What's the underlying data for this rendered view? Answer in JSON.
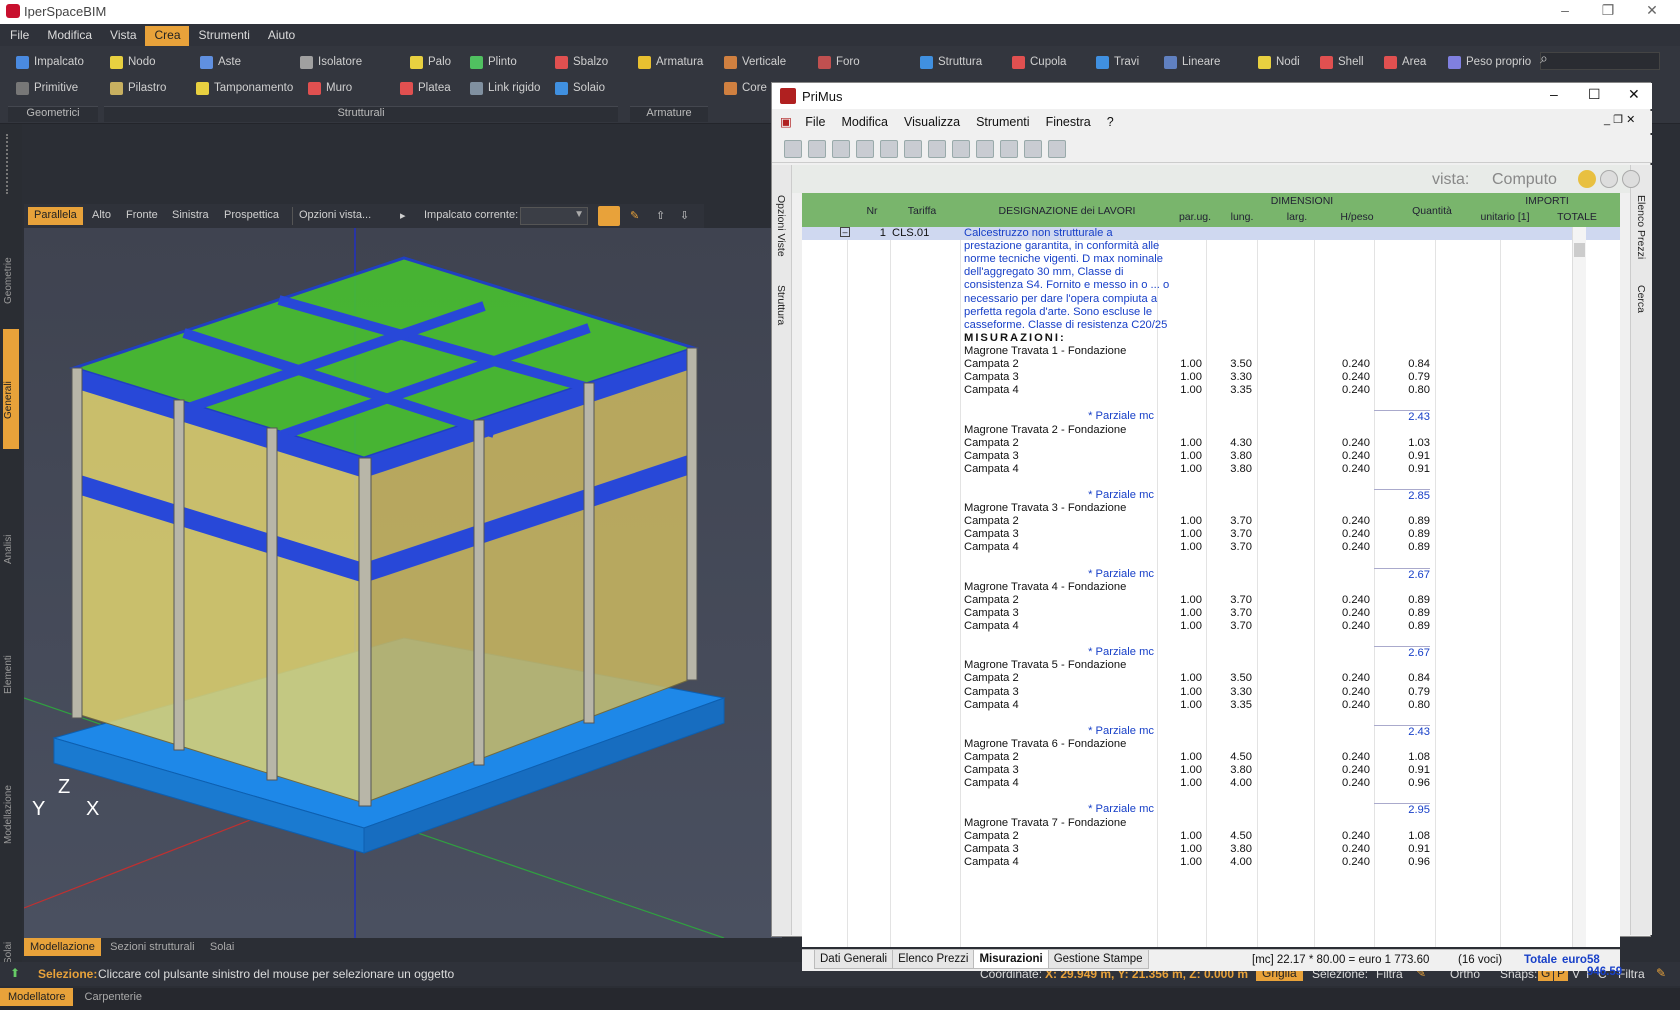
{
  "app": {
    "title": "IperSpaceBIM",
    "menus": [
      "File",
      "Modifica",
      "Vista",
      "Crea",
      "Strumenti",
      "Aiuto"
    ],
    "active_menu": "Crea"
  },
  "ribbon": {
    "row1": [
      "Impalcato",
      "Nodo",
      "Aste",
      "Isolatore",
      "Palo",
      "Plinto",
      "Sbalzo",
      "Armatura",
      "Verticale",
      "Foro",
      "Struttura",
      "Cupola",
      "Travi",
      "Lineare",
      "Nodi",
      "Shell",
      "Area",
      "Peso proprio"
    ],
    "row2": [
      "Primitive",
      "Pilastro",
      "Tamponamento",
      "Muro",
      "Platea",
      "Link rigido",
      "Solaio",
      "Core"
    ],
    "groups": [
      "Geometrici",
      "Strutturali",
      "Armature"
    ]
  },
  "left_tabs": [
    "Geometrie",
    "Generali",
    "Analisi",
    "Elementi",
    "Modellazione",
    "Solai"
  ],
  "active_left_tab": "Generali",
  "viewbar": {
    "buttons": [
      "Parallela",
      "Alto",
      "Fronte",
      "Sinistra",
      "Prospettica"
    ],
    "options": "Opzioni vista...",
    "impalcato_label": "Impalcato corrente:",
    "active": "Parallela"
  },
  "axes": {
    "z": "Z",
    "y": "Y",
    "x": "X"
  },
  "bottom_tabs": [
    "Modellazione",
    "Sezioni strutturali",
    "Solai"
  ],
  "status": {
    "label": "Selezione:",
    "message": "Cliccare col pulsante sinistro del mouse per selezionare un oggetto",
    "coords_label": "Coordinate:",
    "coords": "X: 29.949 m, Y: 21.356 m, Z: 0.000 m",
    "griglia": "Griglia",
    "selezione": "Selezione:",
    "filtra": "Filtra",
    "ortho": "Ortho",
    "snaps": "Snaps:",
    "snap_keys": [
      "G",
      "P",
      "V",
      "I",
      "C"
    ],
    "filtra2": "Filtra"
  },
  "foot_tabs": [
    "Modellatore",
    "Carpenterie"
  ],
  "primus": {
    "title": "PriMus",
    "menus": [
      "File",
      "Modifica",
      "Visualizza",
      "Strumenti",
      "Finestra",
      "?"
    ],
    "side_left": [
      "Opzioni Viste",
      "Struttura"
    ],
    "side_right": [
      "Elenco Prezzi",
      "Cerca"
    ],
    "vista_label": "vista:",
    "vista_value": "Computo",
    "headers": {
      "nr": "Nr",
      "tariffa": "Tariffa",
      "designazione": "DESIGNAZIONE dei LAVORI",
      "dimensioni": "DIMENSIONI",
      "par_ug": "par.ug.",
      "lung": "lung.",
      "larg": "larg.",
      "hpeso": "H/peso",
      "quantita": "Quantità",
      "importi": "IMPORTI",
      "unitario": "unitario [1]",
      "totale": "TOTALE"
    },
    "item": {
      "nr": "1",
      "tariffa": "CLS.01",
      "desc": [
        "Calcestruzzo non strutturale a",
        "prestazione garantita, in conformità alle",
        "norme tecniche vigenti. D max nominale",
        "dell'aggregato 30 mm, Classe di",
        "consistenza S4. Fornito e messo in o ... o",
        "necessario per dare l'opera compiuta a",
        "perfetta regola d'arte. Sono escluse le",
        "casseforme. Classe di resistenza C20/25"
      ],
      "misurazioni": "MISURAZIONI:"
    },
    "groups": [
      {
        "title": "Magrone Travata 1 - Fondazione",
        "rows": [
          [
            "Campata 2",
            "1.00",
            "3.50",
            "0.240",
            "0.84"
          ],
          [
            "Campata 3",
            "1.00",
            "3.30",
            "0.240",
            "0.79"
          ],
          [
            "Campata 4",
            "1.00",
            "3.35",
            "0.240",
            "0.80"
          ]
        ],
        "partial_label": "* Parziale mc",
        "partial": "2.43"
      },
      {
        "title": "Magrone Travata 2 - Fondazione",
        "rows": [
          [
            "Campata 2",
            "1.00",
            "4.30",
            "0.240",
            "1.03"
          ],
          [
            "Campata 3",
            "1.00",
            "3.80",
            "0.240",
            "0.91"
          ],
          [
            "Campata 4",
            "1.00",
            "3.80",
            "0.240",
            "0.91"
          ]
        ],
        "partial_label": "* Parziale mc",
        "partial": "2.85"
      },
      {
        "title": "Magrone Travata 3 - Fondazione",
        "rows": [
          [
            "Campata 2",
            "1.00",
            "3.70",
            "0.240",
            "0.89"
          ],
          [
            "Campata 3",
            "1.00",
            "3.70",
            "0.240",
            "0.89"
          ],
          [
            "Campata 4",
            "1.00",
            "3.70",
            "0.240",
            "0.89"
          ]
        ],
        "partial_label": "* Parziale mc",
        "partial": "2.67"
      },
      {
        "title": "Magrone Travata 4 - Fondazione",
        "rows": [
          [
            "Campata 2",
            "1.00",
            "3.70",
            "0.240",
            "0.89"
          ],
          [
            "Campata 3",
            "1.00",
            "3.70",
            "0.240",
            "0.89"
          ],
          [
            "Campata 4",
            "1.00",
            "3.70",
            "0.240",
            "0.89"
          ]
        ],
        "partial_label": "* Parziale mc",
        "partial": "2.67"
      },
      {
        "title": "Magrone Travata 5 - Fondazione",
        "rows": [
          [
            "Campata 2",
            "1.00",
            "3.50",
            "0.240",
            "0.84"
          ],
          [
            "Campata 3",
            "1.00",
            "3.30",
            "0.240",
            "0.79"
          ],
          [
            "Campata 4",
            "1.00",
            "3.35",
            "0.240",
            "0.80"
          ]
        ],
        "partial_label": "* Parziale mc",
        "partial": "2.43"
      },
      {
        "title": "Magrone Travata 6 - Fondazione",
        "rows": [
          [
            "Campata 2",
            "1.00",
            "4.50",
            "0.240",
            "1.08"
          ],
          [
            "Campata 3",
            "1.00",
            "3.80",
            "0.240",
            "0.91"
          ],
          [
            "Campata 4",
            "1.00",
            "4.00",
            "0.240",
            "0.96"
          ]
        ],
        "partial_label": "* Parziale mc",
        "partial": "2.95"
      },
      {
        "title": "Magrone Travata 7 - Fondazione",
        "rows": [
          [
            "Campata 2",
            "1.00",
            "4.50",
            "0.240",
            "1.08"
          ],
          [
            "Campata 3",
            "1.00",
            "3.80",
            "0.240",
            "0.91"
          ],
          [
            "Campata 4",
            "1.00",
            "4.00",
            "0.240",
            "0.96"
          ]
        ]
      }
    ],
    "tabs": [
      "Dati Generali",
      "Elenco Prezzi",
      "Misurazioni",
      "Gestione Stampe"
    ],
    "active_tab": "Misurazioni",
    "summary": "[mc] 22.17 * 80.00 = euro 1 773.60",
    "voci": "(16 voci)",
    "totale_label": "Totale",
    "totale_euro": "euro",
    "totale_value": "58 946.59"
  },
  "colors": {
    "accent": "#e8a23a",
    "header_green": "#79b56c",
    "blue_text": "#1840c8"
  }
}
